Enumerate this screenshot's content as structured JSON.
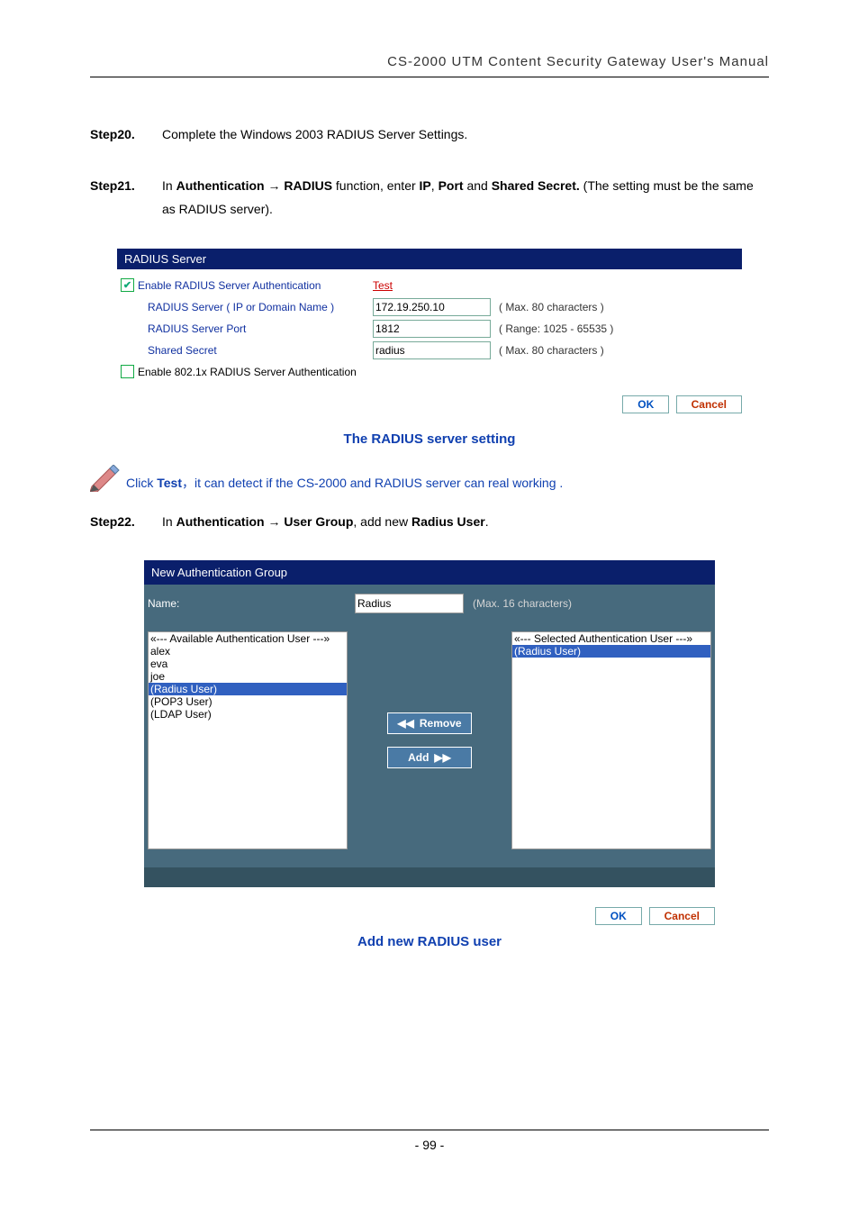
{
  "header": "CS-2000 UTM Content Security Gateway User's Manual",
  "step20": {
    "label": "Step20.",
    "text": "Complete the Windows 2003 RADIUS Server Settings."
  },
  "step21": {
    "label": "Step21.",
    "t1": "In ",
    "b1": "Authentication",
    "arrow": " → ",
    "b2": "RADIUS",
    "t2": " function, enter ",
    "b3": "IP",
    "t3": ", ",
    "b4": "Port",
    "t4": " and ",
    "b5": "Shared Secret.",
    "t5": " (The setting must be the same as RADIUS server)."
  },
  "radius": {
    "header": "RADIUS Server",
    "enable_label": "Enable RADIUS Server Authentication",
    "test_link": "Test",
    "server_label": "RADIUS Server ( IP or Domain Name )",
    "server_value": "172.19.250.10",
    "server_hint": "( Max. 80 characters )",
    "port_label": "RADIUS Server Port",
    "port_value": "1812",
    "port_hint": "( Range: 1025 - 65535 )",
    "secret_label": "Shared Secret",
    "secret_value": "radius",
    "secret_hint": "( Max. 80 characters )",
    "enable8021x_label": "Enable 802.1x RADIUS Server Authentication",
    "ok": "OK",
    "cancel": "Cancel"
  },
  "caption1": "The RADIUS server setting",
  "note": {
    "t1": "Click ",
    "b1": "Test",
    "t2": "，it can detect if the CS-2000 and RADIUS server can real working ."
  },
  "step22": {
    "label": "Step22.",
    "t1": "In ",
    "b1": "Authentication",
    "arrow": " → ",
    "b2": "User Group",
    "t2": ", add new ",
    "b3": "Radius User",
    "t3": "."
  },
  "group": {
    "header": "New Authentication Group",
    "name_label": "Name:",
    "name_value": "Radius",
    "name_hint": "(Max. 16 characters)",
    "available_header": "«--- Available Authentication User ---»",
    "available": [
      "alex",
      "eva",
      "joe",
      "(Radius User)",
      "(POP3 User)",
      "(LDAP User)"
    ],
    "selected_header": "«--- Selected Authentication User ---»",
    "selected": [
      "(Radius User)"
    ],
    "remove": "Remove",
    "add": "Add",
    "ok": "OK",
    "cancel": "Cancel"
  },
  "caption2": "Add new RADIUS user",
  "page_number": "- 99 -"
}
